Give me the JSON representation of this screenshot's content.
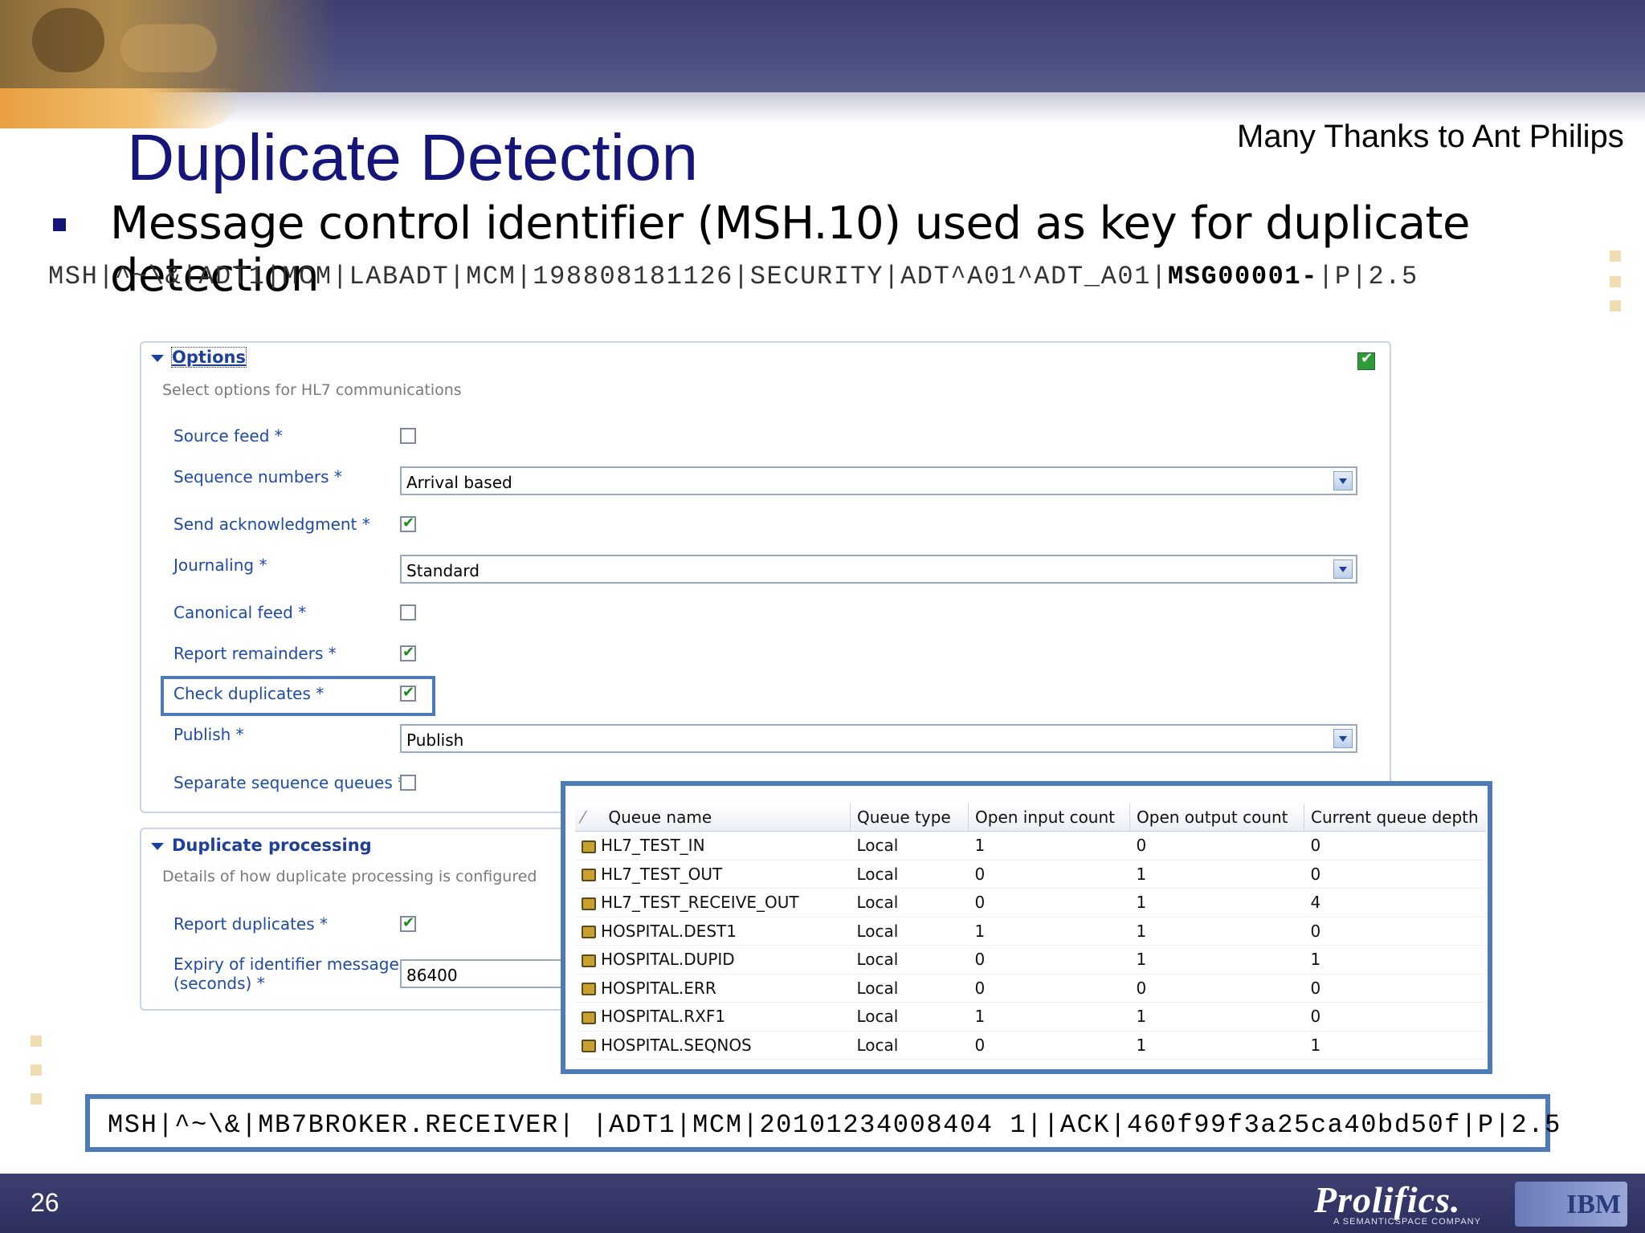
{
  "slide": {
    "title": "Duplicate Detection",
    "credit": "Many Thanks to Ant Philips",
    "bullet": "Message control identifier (MSH.10) used as key for duplicate detection",
    "msh_prefix": "MSH|^~\\&|ADT1|MCM|LABADT|MCM|198808181126|SECURITY|ADT^A01^ADT_A01|",
    "msh_key": "MSG00001-",
    "msh_suffix": "|P|2.5",
    "ack": "MSH|^~\\&|MB7BROKER.RECEIVER| |ADT1|MCM|20101234008404 1||ACK|460f99f3a25ca40bd50f|P|2.5",
    "page_number": "26"
  },
  "options_panel": {
    "heading": "Options",
    "description": "Select options for HL7 communications",
    "fields": {
      "source_feed": {
        "label": "Source feed *",
        "checked": false
      },
      "sequence_numbers": {
        "label": "Sequence numbers *",
        "value": "Arrival based"
      },
      "send_ack": {
        "label": "Send acknowledgment *",
        "checked": true
      },
      "journaling": {
        "label": "Journaling *",
        "value": "Standard"
      },
      "canonical_feed": {
        "label": "Canonical feed *",
        "checked": false
      },
      "report_remainders": {
        "label": "Report remainders *",
        "checked": true
      },
      "check_duplicates": {
        "label": "Check duplicates *",
        "checked": true
      },
      "publish": {
        "label": "Publish *",
        "value": "Publish"
      },
      "separate_queues": {
        "label": "Separate sequence queues *",
        "checked": false
      }
    }
  },
  "duplicate_panel": {
    "heading": "Duplicate processing",
    "description": "Details of how duplicate processing is configured",
    "report_duplicates": {
      "label": "Report duplicates *",
      "checked": true
    },
    "expiry_label_1": "Expiry of identifier messages",
    "expiry_label_2": "(seconds) *",
    "expiry_value": "86400"
  },
  "queue_table": {
    "columns": [
      "Queue name",
      "Queue type",
      "Open input count",
      "Open output count",
      "Current queue depth"
    ],
    "rows": [
      [
        "HL7_TEST_IN",
        "Local",
        "1",
        "0",
        "0"
      ],
      [
        "HL7_TEST_OUT",
        "Local",
        "0",
        "1",
        "0"
      ],
      [
        "HL7_TEST_RECEIVE_OUT",
        "Local",
        "0",
        "1",
        "4"
      ],
      [
        "HOSPITAL.DEST1",
        "Local",
        "1",
        "1",
        "0"
      ],
      [
        "HOSPITAL.DUPID",
        "Local",
        "0",
        "1",
        "1"
      ],
      [
        "HOSPITAL.ERR",
        "Local",
        "0",
        "0",
        "0"
      ],
      [
        "HOSPITAL.RXF1",
        "Local",
        "1",
        "1",
        "0"
      ],
      [
        "HOSPITAL.SEQNOS",
        "Local",
        "0",
        "1",
        "1"
      ]
    ]
  },
  "footer": {
    "logo": "Prolifics.",
    "logo_sub": "A SEMANTICSPACE COMPANY",
    "ibm": "IBM"
  },
  "colors": {
    "title": "#15157a",
    "label": "#1e4aa8",
    "highlight": "#4f7ab8"
  }
}
